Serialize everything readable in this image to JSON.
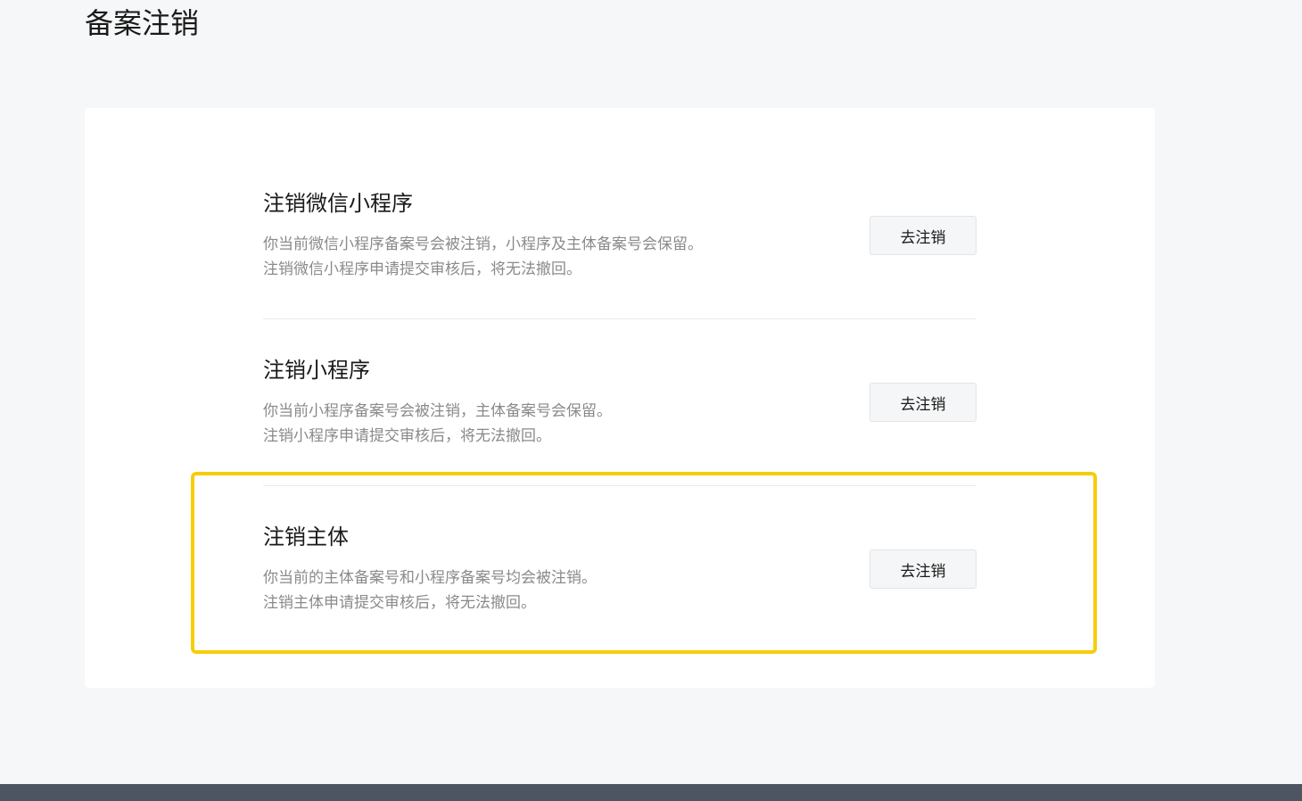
{
  "page": {
    "title": "备案注销"
  },
  "sections": [
    {
      "title": "注销微信小程序",
      "desc": [
        "你当前微信小程序备案号会被注销，小程序及主体备案号会保留。",
        "注销微信小程序申请提交审核后，将无法撤回。"
      ],
      "button_label": "去注销"
    },
    {
      "title": "注销小程序",
      "desc": [
        "你当前小程序备案号会被注销，主体备案号会保留。",
        "注销小程序申请提交审核后，将无法撤回。"
      ],
      "button_label": "去注销"
    },
    {
      "title": "注销主体",
      "desc": [
        "你当前的主体备案号和小程序备案号均会被注销。",
        "注销主体申请提交审核后，将无法撤回。"
      ],
      "button_label": "去注销"
    }
  ],
  "colors": {
    "background": "#f6f7f9",
    "card": "#ffffff",
    "highlight": "#f7cd08",
    "footer": "#4d5563",
    "desc_text": "#8a8a8a"
  }
}
